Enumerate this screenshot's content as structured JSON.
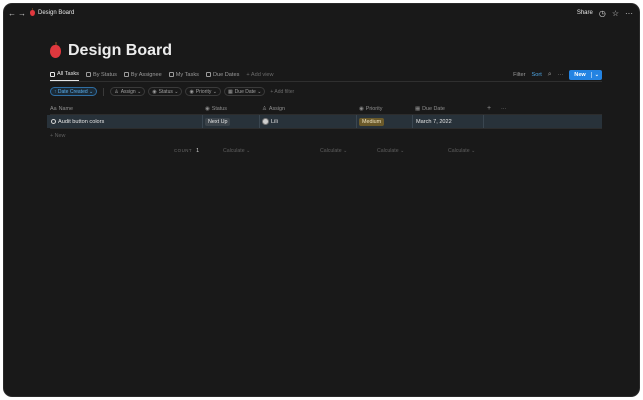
{
  "window": {
    "nav_back": "←",
    "nav_forward": "→",
    "breadcrumb": "Design Board",
    "share_label": "Share",
    "clock_icon": "◷",
    "star_icon": "☆",
    "more_icon": "···"
  },
  "page": {
    "title": "Design Board"
  },
  "views": {
    "tabs": [
      {
        "label": "All Tasks",
        "active": true
      },
      {
        "label": "By Status",
        "active": false
      },
      {
        "label": "By Assignee",
        "active": false
      },
      {
        "label": "My Tasks",
        "active": false
      },
      {
        "label": "Due Dates",
        "active": false
      }
    ],
    "add_view": "+ Add view",
    "filter_label": "Filter",
    "sort_label": "Sort",
    "search_icon": "⌕",
    "more_icon": "···",
    "new_label": "New",
    "new_caret": "⌄"
  },
  "filters": {
    "sort_pill": "↑ Date Created ⌄",
    "pills": [
      {
        "label": "Assign ⌄",
        "icon": "person-icon"
      },
      {
        "label": "Status ⌄",
        "icon": "status-icon"
      },
      {
        "label": "Priority ⌄",
        "icon": "priority-icon"
      },
      {
        "label": "Due Date ⌄",
        "icon": "calendar-icon"
      }
    ],
    "add_filter": "+ Add filter"
  },
  "table": {
    "columns": [
      {
        "label": "Name",
        "icon": "text-icon"
      },
      {
        "label": "Status",
        "icon": "status-icon"
      },
      {
        "label": "Assign",
        "icon": "person-icon"
      },
      {
        "label": "Priority",
        "icon": "priority-icon"
      },
      {
        "label": "Due Date",
        "icon": "calendar-icon"
      }
    ],
    "add_column": "+",
    "more_column": "···",
    "rows": [
      {
        "name": "Audit button colors",
        "status": "Next Up",
        "assign": "Lili",
        "priority": "Medium",
        "due_date": "March 7, 2022"
      }
    ],
    "new_row": "+ New",
    "count_label": "COUNT",
    "count_value": "1",
    "calculate": "Calculate ⌄"
  },
  "colors": {
    "background": "#191919",
    "accent": "#2383e2",
    "sort_text": "#4ea7e6",
    "medium_tag": "#6b5a2a",
    "row_highlight": "#28323a"
  }
}
